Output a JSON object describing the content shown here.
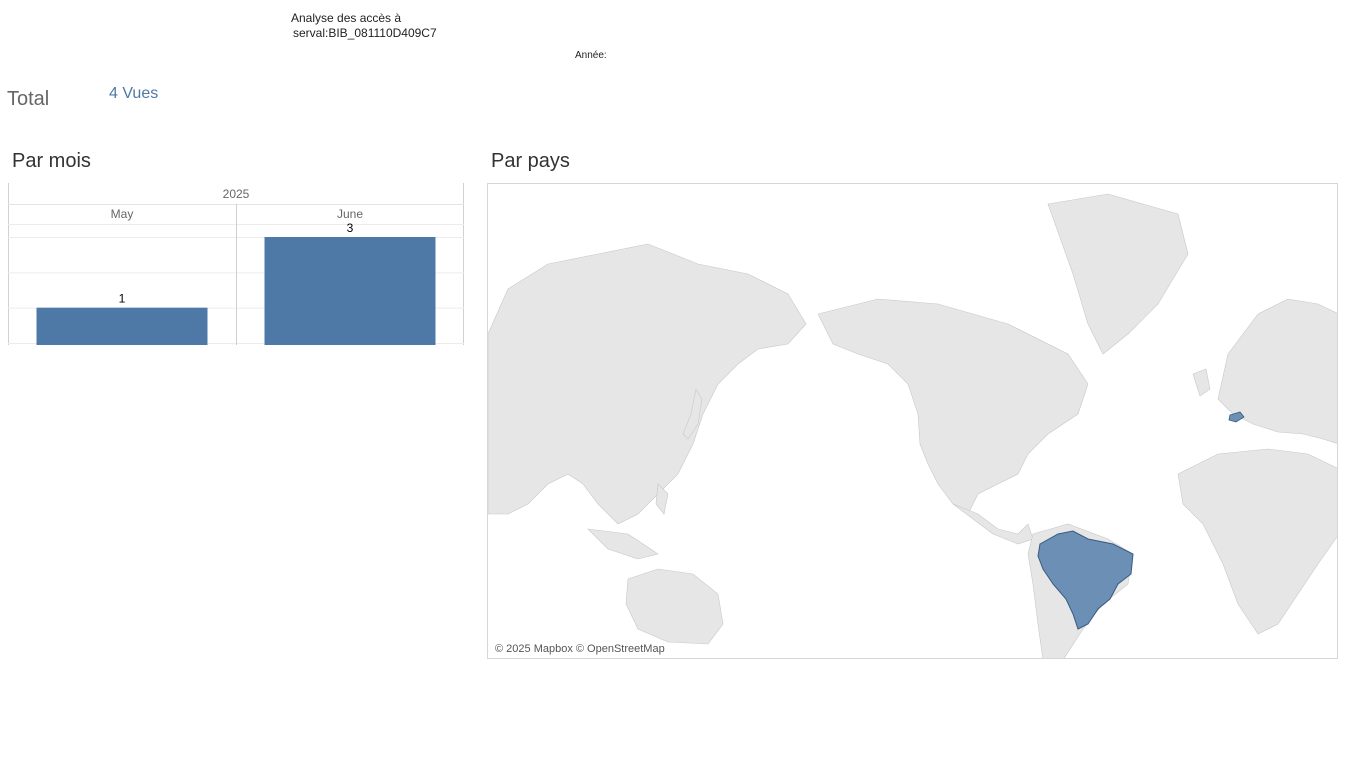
{
  "header": {
    "title_line1": "Analyse des accès à",
    "title_line2": "serval:BIB_081110D409C7",
    "year_filter_label": "Année:"
  },
  "summary": {
    "total_label": "Total",
    "total_value": "4 Vues"
  },
  "sections": {
    "by_month": "Par mois",
    "by_country": "Par pays"
  },
  "chart_data": {
    "type": "bar",
    "title": "Par mois",
    "year": "2025",
    "categories": [
      "May",
      "June"
    ],
    "values": [
      1,
      3
    ],
    "ylim": [
      0,
      3
    ],
    "grid": true,
    "bar_color": "#4e79a7"
  },
  "map": {
    "attribution": "© 2025 Mapbox © OpenStreetMap",
    "highlighted_countries": [
      "Switzerland",
      "Brazil"
    ],
    "highlight_color": "#6b8fb5",
    "land_color": "#e8e8e8"
  }
}
